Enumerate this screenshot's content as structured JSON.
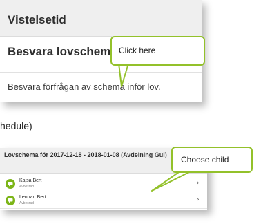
{
  "top_screenshot": {
    "header_title": "Vistelsetid",
    "row_title": "Besvara lovschema",
    "row_description": "Besvara förfrågan av schema inför lov."
  },
  "callouts": {
    "click_here": "Click here",
    "choose_child": "Choose child"
  },
  "caption_fragment": "hedule)",
  "bottom_screenshot": {
    "title": "Lovschema för 2017-12-18 - 2018-01-08 (Avdelning Gul)",
    "children": [
      {
        "name": "Kajsa Bert",
        "status": "Avbesrad",
        "icon": "chat-icon",
        "chevron": "›"
      },
      {
        "name": "Lennart Bert",
        "status": "Avbesrad",
        "icon": "chat-icon",
        "chevron": "›"
      }
    ]
  },
  "colors": {
    "accent_green": "#93c12a",
    "icon_green": "#7cb518",
    "header_gray": "#efefef"
  }
}
